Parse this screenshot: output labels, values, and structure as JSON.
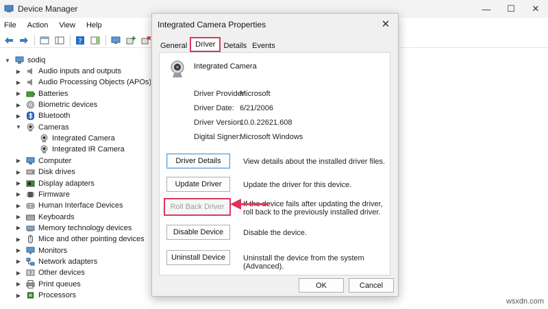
{
  "window": {
    "title": "Device Manager",
    "minimize": "—",
    "maximize": "☐",
    "close": "✕"
  },
  "menu": [
    "File",
    "Action",
    "View",
    "Help"
  ],
  "toolbar": {
    "icons": [
      "back-arrow-icon",
      "forward-arrow-icon",
      "properties-icon",
      "console-tree-icon",
      "help-icon",
      "action-pane-icon",
      "monitor-scan-icon",
      "add-driver-icon",
      "remove-device-icon",
      "update-driver-icon"
    ]
  },
  "tree": {
    "root": "sodiq",
    "items": [
      {
        "label": "Audio inputs and outputs",
        "icon": "speaker-icon"
      },
      {
        "label": "Audio Processing Objects (APOs)",
        "icon": "speaker-icon"
      },
      {
        "label": "Batteries",
        "icon": "battery-icon"
      },
      {
        "label": "Biometric devices",
        "icon": "fingerprint-icon"
      },
      {
        "label": "Bluetooth",
        "icon": "bluetooth-icon"
      },
      {
        "label": "Cameras",
        "icon": "camera-icon",
        "expanded": true
      },
      {
        "label": "Integrated Camera",
        "icon": "camera-icon",
        "child": true
      },
      {
        "label": "Integrated IR Camera",
        "icon": "camera-icon",
        "child": true
      },
      {
        "label": "Computer",
        "icon": "computer-icon"
      },
      {
        "label": "Disk drives",
        "icon": "disk-icon"
      },
      {
        "label": "Display adapters",
        "icon": "display-adapter-icon"
      },
      {
        "label": "Firmware",
        "icon": "chip-icon"
      },
      {
        "label": "Human Interface Devices",
        "icon": "hid-icon"
      },
      {
        "label": "Keyboards",
        "icon": "keyboard-icon"
      },
      {
        "label": "Memory technology devices",
        "icon": "memory-icon"
      },
      {
        "label": "Mice and other pointing devices",
        "icon": "mouse-icon"
      },
      {
        "label": "Monitors",
        "icon": "monitor-icon"
      },
      {
        "label": "Network adapters",
        "icon": "network-icon"
      },
      {
        "label": "Other devices",
        "icon": "other-devices-icon"
      },
      {
        "label": "Print queues",
        "icon": "printer-icon"
      },
      {
        "label": "Processors",
        "icon": "processor-icon"
      }
    ]
  },
  "dialog": {
    "title": "Integrated Camera Properties",
    "close": "✕",
    "tabs": [
      "General",
      "Driver",
      "Details",
      "Events"
    ],
    "active_tab": "Driver",
    "device_name": "Integrated Camera",
    "info": [
      {
        "label": "Driver Provider:",
        "value": "Microsoft"
      },
      {
        "label": "Driver Date:",
        "value": "6/21/2006"
      },
      {
        "label": "Driver Version:",
        "value": "10.0.22621.608"
      },
      {
        "label": "Digital Signer:",
        "value": "Microsoft Windows"
      }
    ],
    "actions": [
      {
        "label": "Driver Details",
        "desc": "View details about the installed driver files."
      },
      {
        "label": "Update Driver",
        "desc": "Update the driver for this device."
      },
      {
        "label": "Roll Back Driver",
        "desc": "If the device fails after updating the driver, roll back to the previously installed driver."
      },
      {
        "label": "Disable Device",
        "desc": "Disable the device."
      },
      {
        "label": "Uninstall Device",
        "desc": "Uninstall the device from the system (Advanced)."
      }
    ],
    "ok": "OK",
    "cancel": "Cancel"
  },
  "highlight_color": "#d9385c",
  "watermark": "wsxdn.com"
}
